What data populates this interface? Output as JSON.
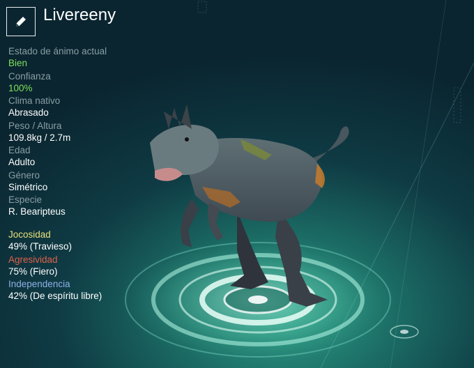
{
  "header": {
    "edit_icon": "pencil-icon",
    "creature_name": "Livereeny"
  },
  "stats": [
    {
      "key": "mood",
      "label": "Estado de ánimo actual",
      "value": "Bien",
      "value_color": "#7ee05a"
    },
    {
      "key": "confidence",
      "label": "Confianza",
      "value": "100%",
      "value_color": "#7ee05a"
    },
    {
      "key": "climate",
      "label": "Clima nativo",
      "value": "Abrasado"
    },
    {
      "key": "weight-height",
      "label": "Peso / Altura",
      "value": "109.8kg / 2.7m"
    },
    {
      "key": "age",
      "label": "Edad",
      "value": "Adulto"
    },
    {
      "key": "gender",
      "label": "Género",
      "value": "Simétrico"
    },
    {
      "key": "species",
      "label": "Especie",
      "value": "R. Bearipteus"
    }
  ],
  "traits": [
    {
      "key": "playfulness",
      "label": "Jocosidad",
      "value": "49% (Travieso)",
      "label_color": "#e8e07a",
      "level_pct": 49
    },
    {
      "key": "aggression",
      "label": "Agresividad",
      "value": "75% (Fiero)",
      "label_color": "#e0604a",
      "level_pct": 75
    },
    {
      "key": "independence",
      "label": "Independencia",
      "value": "42% (De espíritu libre)",
      "label_color": "#8fb0e8",
      "level_pct": 42
    }
  ],
  "colors": {
    "accent_green": "#7ee05a",
    "background_teal": "#1b6b64"
  }
}
